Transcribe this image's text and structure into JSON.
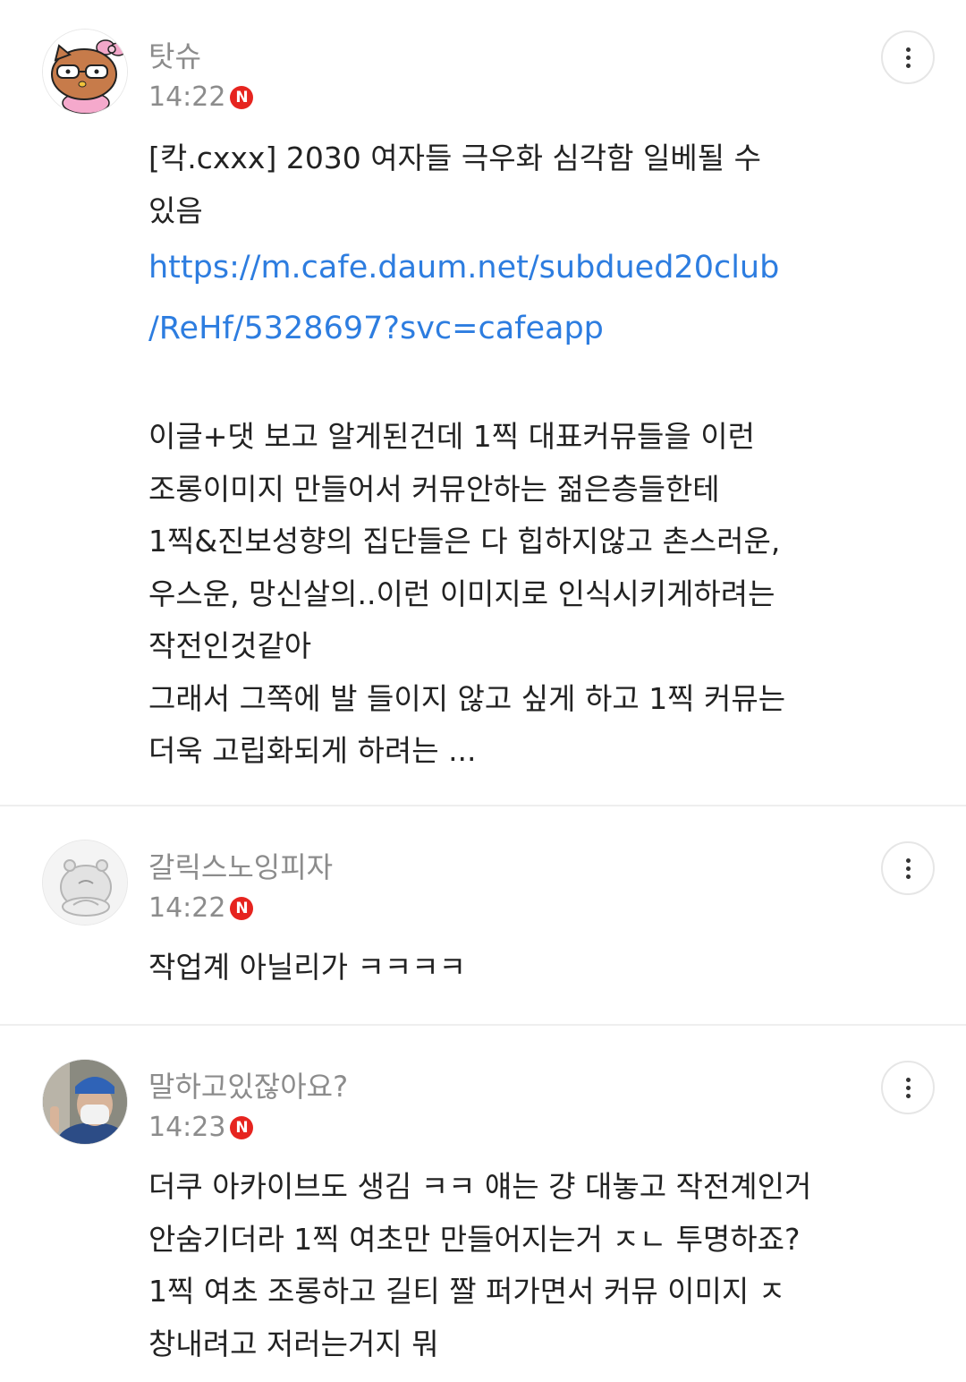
{
  "comments": [
    {
      "nickname": "탓슈",
      "time": "14:22",
      "badge": "N",
      "title_lines": [
        "[칵.cxxx] 2030 여자들 극우화 심각함 일베될 수",
        "있음"
      ],
      "link_lines": [
        "https://m.cafe.daum.net/subdued20club",
        "/ReHf/5328697?svc=cafeapp"
      ],
      "body_lines": [
        "이글+댓 보고 알게된건데 1찍 대표커뮤들을 이런",
        "조롱이미지 만들어서 커뮤안하는 젊은층들한테",
        "1찍&진보성향의 집단들은 다 힙하지않고 촌스러운,",
        "우스운, 망신살의..이런 이미지로 인식시키게하려는",
        "작전인것같아",
        "그래서 그쪽에 발 들이지 않고 싶게 하고 1찍 커뮤는",
        "더욱 고립화되게 하려는 ..."
      ],
      "avatar_icon": "hello-kitty-avatar-icon"
    },
    {
      "nickname": "갈릭스노잉피자",
      "time": "14:22",
      "badge": "N",
      "body_lines": [
        "작업계 아닐리가 ㅋㅋㅋㅋ"
      ],
      "avatar_icon": "default-hippo-avatar-icon"
    },
    {
      "nickname": "말하고있잖아요?",
      "time": "14:23",
      "badge": "N",
      "body_lines": [
        "더쿠 아카이브도 생김 ㅋㅋ 얘는 걍 대놓고 작전계인거",
        "안숨기더라 1찍 여초만 만들어지는거 ㅈㄴ 투명하죠?",
        "1찍 여초 조롱하고 길티 짤 퍼가면서 커뮤 이미지 ㅈ",
        "창내려고 저러는거지 뭐"
      ],
      "avatar_icon": "person-photo-avatar-icon"
    }
  ],
  "colors": {
    "meta_gray": "#8c8c8c",
    "link_blue": "#2d7de0",
    "badge_red": "#e6241f",
    "divider": "#eeeeee"
  },
  "more_icon": "more-vertical-icon"
}
